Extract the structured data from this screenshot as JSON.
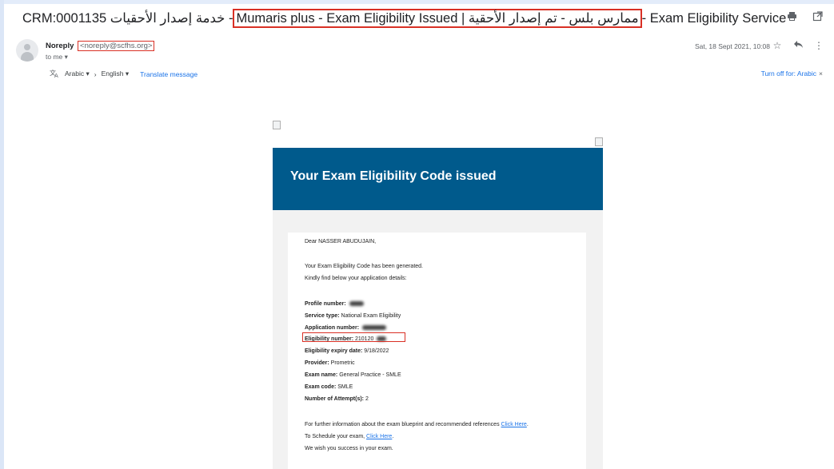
{
  "subject": {
    "prefix": "CRM:0001135 خدمة إصدار الأحقيات - ",
    "boxed": "ممارس بلس - تم إصدار الأحقية | Mumaris plus - Exam Eligibility Issued",
    "suffix": " - Exam Eligibility Service"
  },
  "toolbar": {
    "print_icon": "print-icon",
    "popout_icon": "open-in-new-window-icon"
  },
  "sender": {
    "name": "Noreply",
    "email": "<noreply@scfhs.org>",
    "to": "to me"
  },
  "date": "Sat, 18 Sept 2021, 10:08",
  "translate": {
    "from": "Arabic",
    "to": "English",
    "action": "Translate message",
    "turn_off": "Turn off for: Arabic"
  },
  "email": {
    "banner_title": "Your Exam Eligibility Code issued",
    "greeting": "Dear NASSER ABUDUJAIN,",
    "intro1": "Your Exam Eligibility Code has been generated.",
    "intro2": "Kindly find below your application details:",
    "fields": {
      "profile_label": "Profile number:",
      "service_label": "Service type:",
      "service_value": " National Exam Eligibility",
      "application_label": "Application number:",
      "eligibility_label": "Eligibility number:",
      "eligibility_value": " 210120",
      "expiry_label": "Eligibility expiry date:",
      "expiry_value": " 9/18/2022",
      "provider_label": "Provider:",
      "provider_value": " Prometric",
      "exam_name_label": "Exam name:",
      "exam_name_value": " General Practice - SMLE",
      "exam_code_label": "Exam code:",
      "exam_code_value": " SMLE",
      "attempts_label": "Number of Attempt(s):",
      "attempts_value": " 2"
    },
    "footer1": "For further information about the exam blueprint and recommended references ",
    "click_here": "Click Here",
    "footer1_end": ".",
    "footer2": "To Schedule your exam, ",
    "footer2_end": ".",
    "footer3": "We wish you success in your exam."
  },
  "colors": {
    "banner": "#005a8c",
    "highlight": "#d93025",
    "link": "#1a73e8"
  }
}
